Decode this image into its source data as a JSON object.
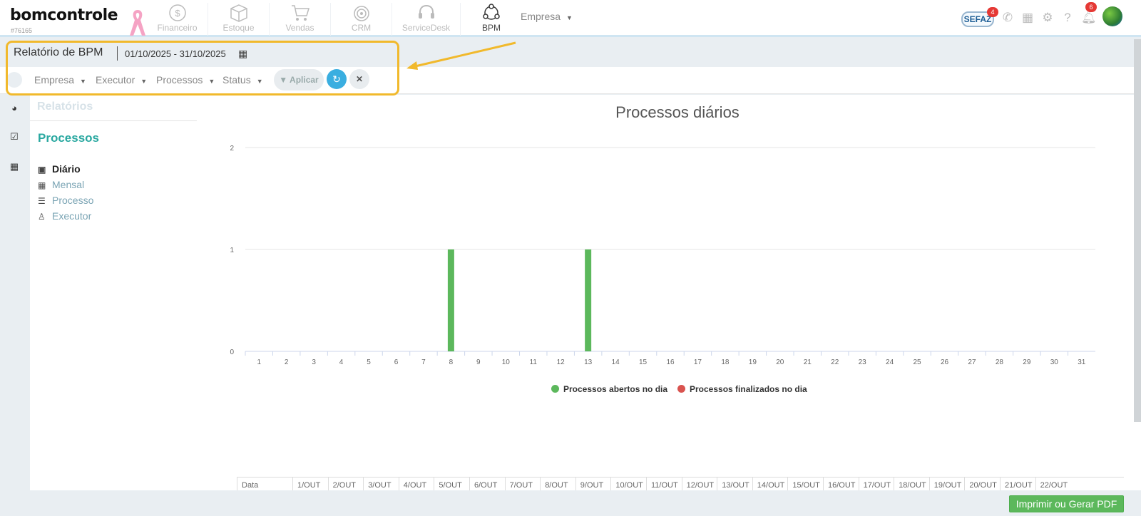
{
  "topnav": {
    "logo": "bomcontrole",
    "logo_id": "#76165",
    "items": [
      {
        "label": "Financeiro",
        "icon": "coin-icon"
      },
      {
        "label": "Estoque",
        "icon": "box-icon"
      },
      {
        "label": "Vendas",
        "icon": "cart-icon"
      },
      {
        "label": "CRM",
        "icon": "target-icon"
      },
      {
        "label": "ServiceDesk",
        "icon": "headset-icon"
      },
      {
        "label": "BPM",
        "icon": "process-icon"
      }
    ],
    "empresa": "Empresa",
    "sefaz": "SEFAZ",
    "sefaz_badge": "4",
    "notif_badge": "6"
  },
  "toolbar": {
    "title": "Relatório de BPM",
    "date_range": "01/10/2025 - 31/10/2025",
    "filters": [
      "Empresa",
      "Executor",
      "Processos",
      "Status"
    ],
    "apply_label": "Aplicar"
  },
  "sidebar": {
    "section": "Relatórios",
    "heading": "Processos",
    "links": [
      {
        "label": "Diário",
        "icon": "calendar-day-icon",
        "active": true
      },
      {
        "label": "Mensal",
        "icon": "calendar-icon",
        "active": false
      },
      {
        "label": "Processo",
        "icon": "list-icon",
        "active": false
      },
      {
        "label": "Executor",
        "icon": "user-icon",
        "active": false
      }
    ]
  },
  "colors": {
    "accent_teal": "#29a8a0",
    "bar_green": "#5cb85c",
    "bar_red": "#d9534f",
    "highlight": "#f1b92c"
  },
  "chart_data": {
    "type": "bar",
    "title": "Processos diários",
    "categories": [
      "1",
      "2",
      "3",
      "4",
      "5",
      "6",
      "7",
      "8",
      "9",
      "10",
      "11",
      "12",
      "13",
      "14",
      "15",
      "16",
      "17",
      "18",
      "19",
      "20",
      "21",
      "22",
      "23",
      "24",
      "25",
      "26",
      "27",
      "28",
      "29",
      "30",
      "31"
    ],
    "series": [
      {
        "name": "Processos abertos no dia",
        "color": "#5cb85c",
        "values": [
          0,
          0,
          0,
          0,
          0,
          0,
          0,
          1,
          0,
          0,
          0,
          0,
          1,
          0,
          0,
          0,
          0,
          0,
          0,
          0,
          0,
          0,
          0,
          0,
          0,
          0,
          0,
          0,
          0,
          0,
          0
        ]
      },
      {
        "name": "Processos finalizados no dia",
        "color": "#d9534f",
        "values": [
          0,
          0,
          0,
          0,
          0,
          0,
          0,
          0,
          0,
          0,
          0,
          0,
          0,
          0,
          0,
          0,
          0,
          0,
          0,
          0,
          0,
          0,
          0,
          0,
          0,
          0,
          0,
          0,
          0,
          0,
          0
        ]
      }
    ],
    "yticks": [
      "0",
      "1",
      "2"
    ],
    "ylim": [
      0,
      2
    ],
    "legend": "bottom-center",
    "grid": true
  },
  "table": {
    "headers": [
      "Data",
      "1/OUT",
      "2/OUT",
      "3/OUT",
      "4/OUT",
      "5/OUT",
      "6/OUT",
      "7/OUT",
      "8/OUT",
      "9/OUT",
      "10/OUT",
      "11/OUT",
      "12/OUT",
      "13/OUT",
      "14/OUT",
      "15/OUT",
      "16/OUT",
      "17/OUT",
      "18/OUT",
      "19/OUT",
      "20/OUT",
      "21/OUT",
      "22/OUT"
    ]
  },
  "footer": {
    "print_label": "Imprimir ou Gerar PDF"
  }
}
